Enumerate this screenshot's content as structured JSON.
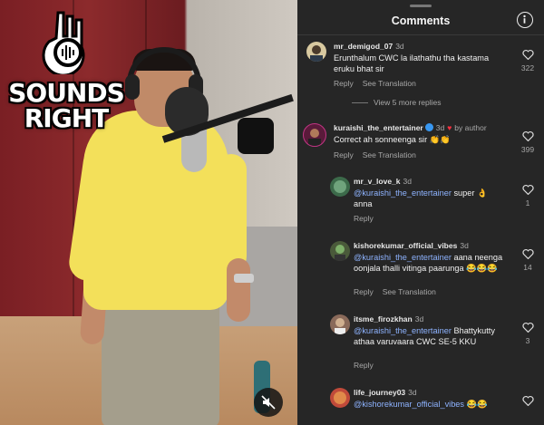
{
  "video": {
    "logo_line1": "SOUNDS",
    "logo_line2": "RIGHT"
  },
  "panel": {
    "title": "Comments"
  },
  "comments": [
    {
      "user": "mr_demigod_07",
      "time": "3d",
      "text": "Erunthalum CWC la ilathathu tha kastama eruku bhat sir",
      "reply": "Reply",
      "translate": "See Translation",
      "likes": "322",
      "view_replies": "View 5 more replies"
    },
    {
      "user": "kuraishi_the_entertainer",
      "time": "3d",
      "by": "by author",
      "text": "Correct ah sonneenga sir 👏👏",
      "reply": "Reply",
      "translate": "See Translation",
      "likes": "399"
    }
  ],
  "replies": [
    {
      "user": "mr_v_love_k",
      "time": "3d",
      "mention": "@kuraishi_the_entertainer",
      "text": " super 👌 anna",
      "reply": "Reply",
      "likes": "1"
    },
    {
      "user": "kishorekumar_official_vibes",
      "time": "3d",
      "mention": "@kuraishi_the_entertainer",
      "text": " aana neenga oonjala thalli vitinga paarunga 😂😂😂",
      "reply": "Reply",
      "translate": "See Translation",
      "likes": "14"
    },
    {
      "user": "itsme_firozkhan",
      "time": "3d",
      "mention": "@kuraishi_the_entertainer",
      "text": " Bhattykutty athaa varuvaara CWC SE-5 KKU",
      "reply": "Reply",
      "likes": "3"
    },
    {
      "user": "life_journey03",
      "time": "3d",
      "mention": "@kishorekumar_official_vibes",
      "text": " 😂😂",
      "likes": ""
    }
  ]
}
